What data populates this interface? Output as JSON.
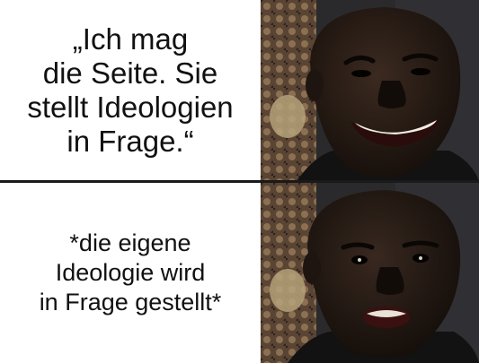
{
  "panels": [
    {
      "caption": "„Ich mag\ndie Seite. Sie\nstellt Ideologien\nin Frage.“",
      "image": "man-smiling-happily"
    },
    {
      "caption": "*die eigene\nIdeologie wird\nin Frage gestellt*",
      "image": "man-disappointed-mouth-open"
    }
  ],
  "colors": {
    "divider": "#1a1a1a",
    "text": "#111111",
    "background": "#ffffff"
  }
}
